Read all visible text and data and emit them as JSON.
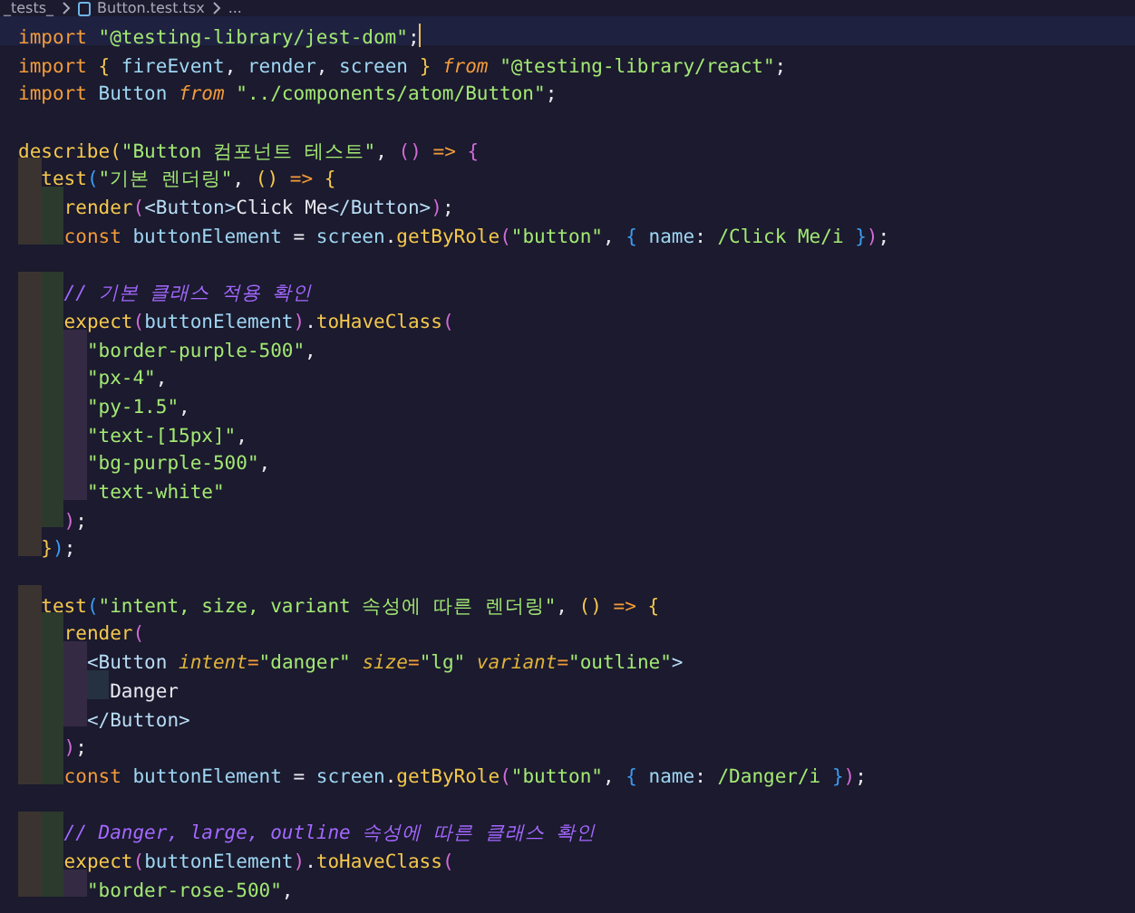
{
  "breadcrumb": [
    "_tests_",
    "Button.test.tsx",
    "..."
  ],
  "lines": [
    {
      "kind": "code",
      "current": true,
      "tokens": [
        {
          "kind": "kw",
          "text": "import"
        },
        {
          "kind": "str",
          "text": " \"@testing-library/jest-dom\""
        },
        {
          "kind": "p",
          "text": ";"
        }
      ]
    },
    {
      "kind": "code",
      "current": false,
      "tokens": [
        {
          "kind": "kw",
          "text": "import"
        },
        {
          "kind": "b1",
          "text": " {"
        },
        {
          "kind": "id",
          "text": " fireEvent"
        },
        {
          "kind": "p",
          "text": ","
        },
        {
          "kind": "id",
          "text": " render"
        },
        {
          "kind": "p",
          "text": ","
        },
        {
          "kind": "id",
          "text": " screen "
        },
        {
          "kind": "b1",
          "text": "}"
        },
        {
          "kind": "kwi",
          "text": " from"
        },
        {
          "kind": "str",
          "text": " \"@testing-library/react\""
        },
        {
          "kind": "p",
          "text": ";"
        }
      ]
    },
    {
      "kind": "code",
      "current": false,
      "tokens": [
        {
          "kind": "kw",
          "text": "import"
        },
        {
          "kind": "id",
          "text": " Button "
        },
        {
          "kind": "kwi",
          "text": "from"
        },
        {
          "kind": "str",
          "text": " \"../components/atom/Button\""
        },
        {
          "kind": "p",
          "text": ";"
        }
      ]
    },
    {
      "kind": "blank"
    },
    {
      "kind": "code",
      "current": false,
      "tokens": [
        {
          "kind": "fn",
          "text": "describe"
        },
        {
          "kind": "b1",
          "text": "("
        },
        {
          "kind": "str",
          "text": "\"Button 컴포넌트 테스트\""
        },
        {
          "kind": "p",
          "text": ","
        },
        {
          "kind": "b2",
          "text": " ()"
        },
        {
          "kind": "kw",
          "text": " =>"
        },
        {
          "kind": "b2",
          "text": " {"
        }
      ]
    },
    {
      "kind": "code",
      "current": false,
      "tokens": [
        {
          "kind": "fn",
          "text": "  test"
        },
        {
          "kind": "b3",
          "text": "("
        },
        {
          "kind": "str",
          "text": "\"기본 렌더링\""
        },
        {
          "kind": "p",
          "text": ","
        },
        {
          "kind": "b1",
          "text": " ()"
        },
        {
          "kind": "kw",
          "text": " =>"
        },
        {
          "kind": "b1",
          "text": " {"
        }
      ]
    },
    {
      "kind": "code",
      "current": false,
      "tokens": [
        {
          "kind": "fn",
          "text": "    render"
        },
        {
          "kind": "b2",
          "text": "("
        },
        {
          "kind": "tag",
          "text": "<Button>"
        },
        {
          "kind": "p",
          "text": "Click Me"
        },
        {
          "kind": "tag",
          "text": "</Button>"
        },
        {
          "kind": "b2",
          "text": ")"
        },
        {
          "kind": "p",
          "text": ";"
        }
      ]
    },
    {
      "kind": "code",
      "current": false,
      "tokens": [
        {
          "kind": "kw",
          "text": "    const"
        },
        {
          "kind": "id",
          "text": " buttonElement"
        },
        {
          "kind": "p",
          "text": " ="
        },
        {
          "kind": "id",
          "text": " screen"
        },
        {
          "kind": "p",
          "text": "."
        },
        {
          "kind": "fn",
          "text": "getByRole"
        },
        {
          "kind": "b2",
          "text": "("
        },
        {
          "kind": "str",
          "text": "\"button\""
        },
        {
          "kind": "p",
          "text": ","
        },
        {
          "kind": "b3",
          "text": " {"
        },
        {
          "kind": "id",
          "text": " name"
        },
        {
          "kind": "p",
          "text": ":"
        },
        {
          "kind": "str",
          "text": " /Click Me/i"
        },
        {
          "kind": "b3",
          "text": " }"
        },
        {
          "kind": "b2",
          "text": ")"
        },
        {
          "kind": "p",
          "text": ";"
        }
      ]
    },
    {
      "kind": "blank"
    },
    {
      "kind": "code",
      "current": false,
      "tokens": [
        {
          "kind": "cm",
          "text": "    // 기본 클래스 적용 확인"
        }
      ]
    },
    {
      "kind": "code",
      "current": false,
      "tokens": [
        {
          "kind": "fn",
          "text": "    expect"
        },
        {
          "kind": "b2",
          "text": "("
        },
        {
          "kind": "id",
          "text": "buttonElement"
        },
        {
          "kind": "b2",
          "text": ")"
        },
        {
          "kind": "p",
          "text": "."
        },
        {
          "kind": "fn",
          "text": "toHaveClass"
        },
        {
          "kind": "b2",
          "text": "("
        }
      ]
    },
    {
      "kind": "code",
      "current": false,
      "tokens": [
        {
          "kind": "str",
          "text": "      \"border-purple-500\""
        },
        {
          "kind": "p",
          "text": ","
        }
      ]
    },
    {
      "kind": "code",
      "current": false,
      "tokens": [
        {
          "kind": "str",
          "text": "      \"px-4\""
        },
        {
          "kind": "p",
          "text": ","
        }
      ]
    },
    {
      "kind": "code",
      "current": false,
      "tokens": [
        {
          "kind": "str",
          "text": "      \"py-1.5\""
        },
        {
          "kind": "p",
          "text": ","
        }
      ]
    },
    {
      "kind": "code",
      "current": false,
      "tokens": [
        {
          "kind": "str",
          "text": "      \"text-[15px]\""
        },
        {
          "kind": "p",
          "text": ","
        }
      ]
    },
    {
      "kind": "code",
      "current": false,
      "tokens": [
        {
          "kind": "str",
          "text": "      \"bg-purple-500\""
        },
        {
          "kind": "p",
          "text": ","
        }
      ]
    },
    {
      "kind": "code",
      "current": false,
      "tokens": [
        {
          "kind": "str",
          "text": "      \"text-white\""
        }
      ]
    },
    {
      "kind": "code",
      "current": false,
      "tokens": [
        {
          "kind": "b2",
          "text": "    )"
        },
        {
          "kind": "p",
          "text": ";"
        }
      ]
    },
    {
      "kind": "code",
      "current": false,
      "tokens": [
        {
          "kind": "b1",
          "text": "  }"
        },
        {
          "kind": "b3",
          "text": ")"
        },
        {
          "kind": "p",
          "text": ";"
        }
      ]
    },
    {
      "kind": "blank"
    },
    {
      "kind": "code",
      "current": false,
      "tokens": [
        {
          "kind": "fn",
          "text": "  test"
        },
        {
          "kind": "b3",
          "text": "("
        },
        {
          "kind": "str",
          "text": "\"intent, size, variant 속성에 따른 렌더링\""
        },
        {
          "kind": "p",
          "text": ","
        },
        {
          "kind": "b1",
          "text": " ()"
        },
        {
          "kind": "kw",
          "text": " =>"
        },
        {
          "kind": "b1",
          "text": " {"
        }
      ]
    },
    {
      "kind": "code",
      "current": false,
      "tokens": [
        {
          "kind": "fn",
          "text": "    render"
        },
        {
          "kind": "b2",
          "text": "("
        }
      ]
    },
    {
      "kind": "code",
      "current": false,
      "tokens": [
        {
          "kind": "tag",
          "text": "      <Button"
        },
        {
          "kind": "attr",
          "text": " intent"
        },
        {
          "kind": "kw",
          "text": "="
        },
        {
          "kind": "str",
          "text": "\"danger\""
        },
        {
          "kind": "attr",
          "text": " size"
        },
        {
          "kind": "kw",
          "text": "="
        },
        {
          "kind": "str",
          "text": "\"lg\""
        },
        {
          "kind": "attr",
          "text": " variant"
        },
        {
          "kind": "kw",
          "text": "="
        },
        {
          "kind": "str",
          "text": "\"outline\""
        },
        {
          "kind": "tag",
          "text": ">"
        }
      ]
    },
    {
      "kind": "code",
      "current": false,
      "tokens": [
        {
          "kind": "p",
          "text": "        Danger"
        }
      ]
    },
    {
      "kind": "code",
      "current": false,
      "tokens": [
        {
          "kind": "tag",
          "text": "      </Button>"
        }
      ]
    },
    {
      "kind": "code",
      "current": false,
      "tokens": [
        {
          "kind": "b2",
          "text": "    )"
        },
        {
          "kind": "p",
          "text": ";"
        }
      ]
    },
    {
      "kind": "code",
      "current": false,
      "tokens": [
        {
          "kind": "kw",
          "text": "    const"
        },
        {
          "kind": "id",
          "text": " buttonElement"
        },
        {
          "kind": "p",
          "text": " ="
        },
        {
          "kind": "id",
          "text": " screen"
        },
        {
          "kind": "p",
          "text": "."
        },
        {
          "kind": "fn",
          "text": "getByRole"
        },
        {
          "kind": "b2",
          "text": "("
        },
        {
          "kind": "str",
          "text": "\"button\""
        },
        {
          "kind": "p",
          "text": ","
        },
        {
          "kind": "b3",
          "text": " {"
        },
        {
          "kind": "id",
          "text": " name"
        },
        {
          "kind": "p",
          "text": ":"
        },
        {
          "kind": "str",
          "text": " /Danger/i"
        },
        {
          "kind": "b3",
          "text": " }"
        },
        {
          "kind": "b2",
          "text": ")"
        },
        {
          "kind": "p",
          "text": ";"
        }
      ]
    },
    {
      "kind": "blank"
    },
    {
      "kind": "code",
      "current": false,
      "tokens": [
        {
          "kind": "cm",
          "text": "    // Danger, large, outline 속성에 따른 클래스 확인"
        }
      ]
    },
    {
      "kind": "code",
      "current": false,
      "tokens": [
        {
          "kind": "fn",
          "text": "    expect"
        },
        {
          "kind": "b2",
          "text": "("
        },
        {
          "kind": "id",
          "text": "buttonElement"
        },
        {
          "kind": "b2",
          "text": ")"
        },
        {
          "kind": "p",
          "text": "."
        },
        {
          "kind": "fn",
          "text": "toHaveClass"
        },
        {
          "kind": "b2",
          "text": "("
        }
      ]
    },
    {
      "kind": "code",
      "current": false,
      "tokens": [
        {
          "kind": "str",
          "text": "      \"border-rose-500\""
        },
        {
          "kind": "p",
          "text": ","
        }
      ]
    }
  ]
}
